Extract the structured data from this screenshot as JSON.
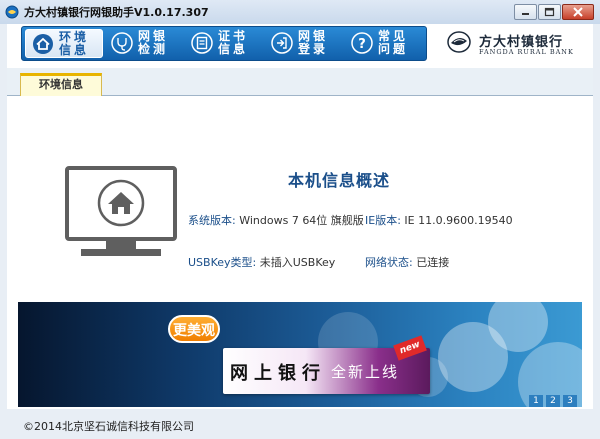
{
  "window": {
    "title": "方大村镇银行网银助手V1.0.17.307"
  },
  "nav": {
    "items": [
      {
        "label": "环境信息",
        "icon": "home-icon"
      },
      {
        "label": "网银检测",
        "icon": "stethoscope-icon"
      },
      {
        "label": "证书信息",
        "icon": "certificate-icon"
      },
      {
        "label": "网银登录",
        "icon": "login-icon"
      },
      {
        "label": "常见问题",
        "icon": "question-icon"
      }
    ],
    "active_index": 0
  },
  "bank": {
    "name_cn": "方大村镇银行",
    "name_en": "FANGDA RURAL BANK"
  },
  "tabs": [
    "环境信息"
  ],
  "info": {
    "title": "本机信息概述",
    "os_label": "系统版本:",
    "os_value": "Windows 7 64位 旗舰版",
    "ie_label": "IE版本:",
    "ie_value": "IE 11.0.9600.19540",
    "usbkey_label": "USBKey类型:",
    "usbkey_value": "未插入USBKey",
    "network_label": "网络状态:",
    "network_value": "已连接"
  },
  "banner": {
    "pill_text": "更美观",
    "main_text": "网上银行",
    "sub_text": "全新上线",
    "badge_text": "new",
    "pages": [
      "1",
      "2",
      "3"
    ],
    "active_page": 1
  },
  "status": {
    "copyright": "©2014北京坚石诚信科技有限公司"
  },
  "colors": {
    "nav_bg": "#1a72c4",
    "accent_text": "#1b4f8a",
    "tab_highlight": "#e8b400"
  }
}
